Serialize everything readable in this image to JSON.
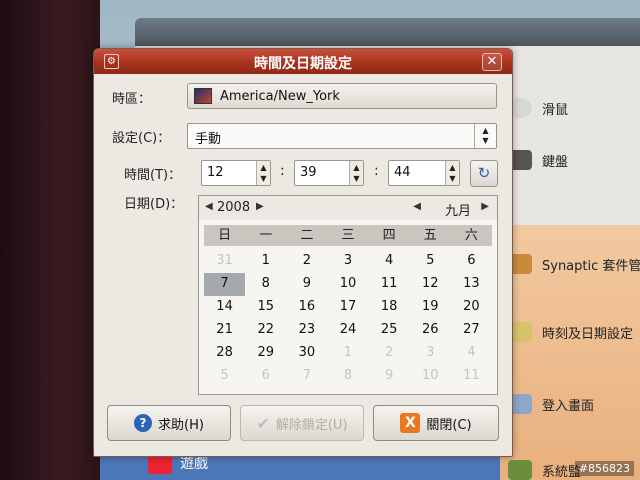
{
  "background": {
    "items": [
      {
        "label": "滑鼠",
        "icon": "mouse-icon"
      },
      {
        "label": "鍵盤",
        "icon": "keyboard-icon"
      },
      {
        "label": "Synaptic 套件管",
        "icon": "package-icon"
      },
      {
        "label": "時刻及日期設定",
        "icon": "clock-icon"
      },
      {
        "label": "登入畫面",
        "icon": "login-icon"
      },
      {
        "label": "系統監",
        "icon": "monitor-icon"
      }
    ],
    "bottom_label": "遊戲",
    "watermark": "#856823"
  },
  "dialog": {
    "title": "時間及日期設定",
    "timezone": {
      "label": "時區：",
      "value": "America/New_York"
    },
    "config": {
      "label": "設定(C)：",
      "value": "手動"
    },
    "time": {
      "label": "時間(T)：",
      "hour": "12",
      "minute": "39",
      "second": "44",
      "sep": ":"
    },
    "date": {
      "label": "日期(D)：",
      "year": "2008",
      "month": "九月",
      "weekdays": [
        "日",
        "一",
        "二",
        "三",
        "四",
        "五",
        "六"
      ],
      "days": [
        {
          "d": "31",
          "other": true
        },
        {
          "d": "1"
        },
        {
          "d": "2"
        },
        {
          "d": "3"
        },
        {
          "d": "4"
        },
        {
          "d": "5"
        },
        {
          "d": "6"
        },
        {
          "d": "7",
          "selected": true
        },
        {
          "d": "8"
        },
        {
          "d": "9"
        },
        {
          "d": "10"
        },
        {
          "d": "11"
        },
        {
          "d": "12"
        },
        {
          "d": "13"
        },
        {
          "d": "14"
        },
        {
          "d": "15"
        },
        {
          "d": "16"
        },
        {
          "d": "17"
        },
        {
          "d": "18"
        },
        {
          "d": "19"
        },
        {
          "d": "20"
        },
        {
          "d": "21"
        },
        {
          "d": "22"
        },
        {
          "d": "23"
        },
        {
          "d": "24"
        },
        {
          "d": "25"
        },
        {
          "d": "26"
        },
        {
          "d": "27"
        },
        {
          "d": "28"
        },
        {
          "d": "29"
        },
        {
          "d": "30"
        },
        {
          "d": "1",
          "other": true
        },
        {
          "d": "2",
          "other": true
        },
        {
          "d": "3",
          "other": true
        },
        {
          "d": "4",
          "other": true
        },
        {
          "d": "5",
          "other": true
        },
        {
          "d": "6",
          "other": true
        },
        {
          "d": "7",
          "other": true
        },
        {
          "d": "8",
          "other": true
        },
        {
          "d": "9",
          "other": true
        },
        {
          "d": "10",
          "other": true
        },
        {
          "d": "11",
          "other": true
        }
      ]
    },
    "buttons": {
      "help": "求助(H)",
      "unlock": "解除鎖定(U)",
      "close": "關閉(C)"
    }
  }
}
